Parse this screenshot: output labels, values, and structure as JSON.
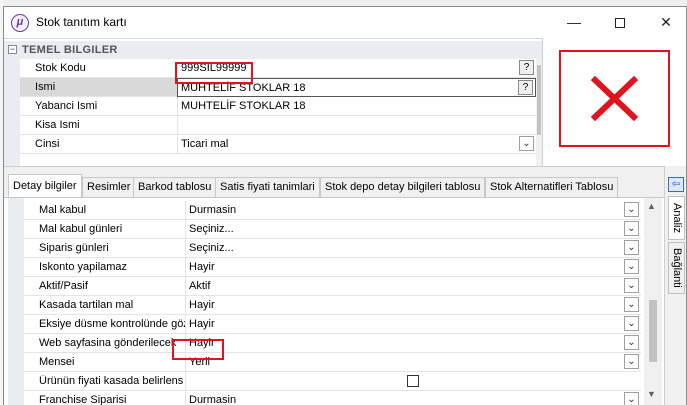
{
  "window": {
    "title": "Stok tanıtım kartı",
    "app_icon_glyph": "μ"
  },
  "title_buttons": {
    "minimize": "—",
    "close": "✕"
  },
  "top_grid": {
    "category": "TEMEL BILGILER",
    "category_toggle": "−",
    "rows": [
      {
        "name": "Stok Kodu",
        "value": "999SIL99999",
        "button": "?"
      },
      {
        "name": "Ismi",
        "value": "MUHTELİF STOKLAR 18",
        "button": "?"
      },
      {
        "name": "Yabanci Ismi",
        "value": "MUHTELİF STOKLAR 18"
      },
      {
        "name": "Kisa Ismi",
        "value": ""
      },
      {
        "name": "Cinsi",
        "value": "Ticari mal",
        "button": "⌄"
      }
    ]
  },
  "picture": {
    "icon": "red-x-icon",
    "color": "#e0141e"
  },
  "tabs": [
    "Detay bilgiler",
    "Resimler",
    "Barkod tablosu",
    "Satis fiyati tanimlari",
    "Stok depo detay bilgileri tablosu",
    "Stok Alternatifleri Tablosu"
  ],
  "detail_rows": [
    {
      "name": "Mal kabul",
      "value": "Durmasin"
    },
    {
      "name": "Mal kabul günleri",
      "value": "Seçiniz..."
    },
    {
      "name": "Siparis günleri",
      "value": "Seçiniz..."
    },
    {
      "name": "Iskonto yapilamaz",
      "value": "Hayir"
    },
    {
      "name": "Aktif/Pasif",
      "value": "Aktif"
    },
    {
      "name": "Kasada tartilan mal",
      "value": "Hayir"
    },
    {
      "name": "Eksiye düsme kontrolünde göz",
      "value": "Hayir"
    },
    {
      "name": "Web sayfasina gönderilecek",
      "value": "Hayir"
    },
    {
      "name": "Mensei",
      "value": "Yerli"
    },
    {
      "name": "Ürünün fiyati kasada belirlens",
      "value": ""
    },
    {
      "name": "Franchise Siparisi",
      "value": "Durmasin"
    }
  ],
  "dropdown_glyph": "⌄",
  "side_tabs": {
    "button": "⇦",
    "analiz": "Analiz",
    "baglanti": "Bağlanti"
  },
  "scroll": {
    "up": "▲",
    "down": "▼"
  },
  "colors": {
    "highlight": "#e0141e",
    "category_bg": "#e9ecf1"
  }
}
